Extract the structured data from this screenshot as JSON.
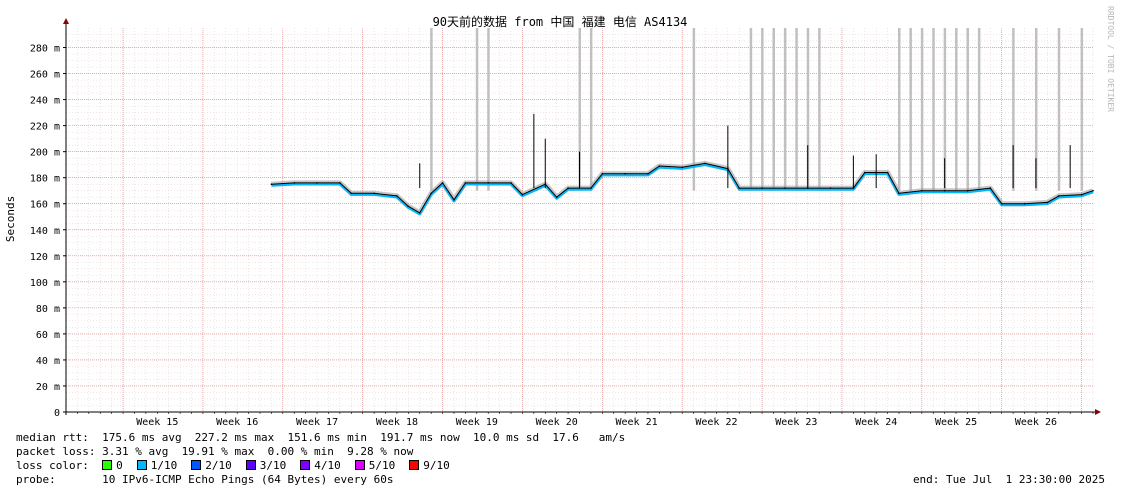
{
  "chart_data": {
    "type": "line",
    "title": "90天前的数据 from 中国 福建 电信 AS4134",
    "ylabel": "Seconds",
    "ylim": [
      0,
      0.295
    ],
    "yticks": [
      {
        "value": 0,
        "label": "0"
      },
      {
        "value": 0.02,
        "label": "20 m"
      },
      {
        "value": 0.04,
        "label": "40 m"
      },
      {
        "value": 0.06,
        "label": "60 m"
      },
      {
        "value": 0.08,
        "label": "80 m"
      },
      {
        "value": 0.1,
        "label": "100 m"
      },
      {
        "value": 0.12,
        "label": "120 m"
      },
      {
        "value": 0.14,
        "label": "140 m"
      },
      {
        "value": 0.16,
        "label": "160 m"
      },
      {
        "value": 0.18,
        "label": "180 m"
      },
      {
        "value": 0.2,
        "label": "200 m"
      },
      {
        "value": 0.22,
        "label": "220 m"
      },
      {
        "value": 0.24,
        "label": "240 m"
      },
      {
        "value": 0.26,
        "label": "260 m"
      },
      {
        "value": 0.28,
        "label": "280 m"
      }
    ],
    "xlim": [
      "2025-04-02",
      "2025-07-01"
    ],
    "week_labels": [
      {
        "date": "2025-04-10",
        "label": "Week 15"
      },
      {
        "date": "2025-04-17",
        "label": "Week 16"
      },
      {
        "date": "2025-04-24",
        "label": "Week 17"
      },
      {
        "date": "2025-05-01",
        "label": "Week 18"
      },
      {
        "date": "2025-05-08",
        "label": "Week 19"
      },
      {
        "date": "2025-05-15",
        "label": "Week 20"
      },
      {
        "date": "2025-05-22",
        "label": "Week 21"
      },
      {
        "date": "2025-05-29",
        "label": "Week 22"
      },
      {
        "date": "2025-06-05",
        "label": "Week 23"
      },
      {
        "date": "2025-06-12",
        "label": "Week 24"
      },
      {
        "date": "2025-06-19",
        "label": "Week 25"
      },
      {
        "date": "2025-06-26",
        "label": "Week 26"
      }
    ],
    "median_rtt_ms": [
      [
        "2025-04-20",
        175
      ],
      [
        "2025-04-22",
        176
      ],
      [
        "2025-04-24",
        176
      ],
      [
        "2025-04-26",
        176
      ],
      [
        "2025-04-27",
        168
      ],
      [
        "2025-04-29",
        168
      ],
      [
        "2025-05-01",
        166
      ],
      [
        "2025-05-02",
        158
      ],
      [
        "2025-05-03",
        153
      ],
      [
        "2025-05-04",
        168
      ],
      [
        "2025-05-05",
        176
      ],
      [
        "2025-05-06",
        163
      ],
      [
        "2025-05-07",
        176
      ],
      [
        "2025-05-09",
        176
      ],
      [
        "2025-05-11",
        176
      ],
      [
        "2025-05-12",
        167
      ],
      [
        "2025-05-14",
        175
      ],
      [
        "2025-05-15",
        165
      ],
      [
        "2025-05-16",
        172
      ],
      [
        "2025-05-18",
        172
      ],
      [
        "2025-05-19",
        183
      ],
      [
        "2025-05-21",
        183
      ],
      [
        "2025-05-23",
        183
      ],
      [
        "2025-05-24",
        189
      ],
      [
        "2025-05-26",
        188
      ],
      [
        "2025-05-28",
        191
      ],
      [
        "2025-05-30",
        187
      ],
      [
        "2025-05-31",
        172
      ],
      [
        "2025-06-02",
        172
      ],
      [
        "2025-06-04",
        172
      ],
      [
        "2025-06-06",
        172
      ],
      [
        "2025-06-08",
        172
      ],
      [
        "2025-06-10",
        172
      ],
      [
        "2025-06-11",
        184
      ],
      [
        "2025-06-13",
        184
      ],
      [
        "2025-06-14",
        168
      ],
      [
        "2025-06-16",
        170
      ],
      [
        "2025-06-18",
        170
      ],
      [
        "2025-06-20",
        170
      ],
      [
        "2025-06-22",
        172
      ],
      [
        "2025-06-23",
        160
      ],
      [
        "2025-06-25",
        160
      ],
      [
        "2025-06-27",
        161
      ],
      [
        "2025-06-28",
        166
      ],
      [
        "2025-06-30",
        167
      ],
      [
        "2025-07-01",
        170
      ]
    ],
    "rtt_spikes_ms": [
      [
        "2025-05-03",
        191
      ],
      [
        "2025-05-13",
        229
      ],
      [
        "2025-05-14",
        210
      ],
      [
        "2025-05-17",
        200
      ],
      [
        "2025-05-30",
        220
      ],
      [
        "2025-06-06",
        205
      ],
      [
        "2025-06-10",
        197
      ],
      [
        "2025-06-12",
        198
      ],
      [
        "2025-06-18",
        195
      ],
      [
        "2025-06-24",
        205
      ],
      [
        "2025-06-26",
        195
      ],
      [
        "2025-06-29",
        205
      ]
    ],
    "loss_bars": [
      "2025-05-04",
      "2025-05-08",
      "2025-05-09",
      "2025-05-17",
      "2025-05-18",
      "2025-05-27",
      "2025-06-01",
      "2025-06-02",
      "2025-06-03",
      "2025-06-04",
      "2025-06-05",
      "2025-06-06",
      "2025-06-07",
      "2025-06-14",
      "2025-06-15",
      "2025-06-16",
      "2025-06-17",
      "2025-06-18",
      "2025-06-19",
      "2025-06-20",
      "2025-06-21",
      "2025-06-24",
      "2025-06-26",
      "2025-06-28",
      "2025-06-30"
    ],
    "watermark": "RRDTOOL / TOBI OETIKER"
  },
  "legend": {
    "median_rtt": "median rtt:  175.6 ms avg  227.2 ms max  151.6 ms min  191.7 ms now  10.0 ms sd  17.6   am/s",
    "packet_loss": "packet loss: 3.31 % avg  19.91 % max  0.00 % min  9.28 % now",
    "loss_color_label": "loss color:  ",
    "loss_colors": [
      {
        "label": "0",
        "color": "#26ff00"
      },
      {
        "label": "1/10",
        "color": "#00b8ff"
      },
      {
        "label": "2/10",
        "color": "#0059ff"
      },
      {
        "label": "3/10",
        "color": "#5e00ff"
      },
      {
        "label": "4/10",
        "color": "#7e00ff"
      },
      {
        "label": "5/10",
        "color": "#dd00ff"
      },
      {
        "label": "9/10",
        "color": "#ff0000"
      }
    ],
    "probe": "probe:       10 IPv6-ICMP Echo Pings (64 Bytes) every 60s",
    "end": "end: Tue Jul  1 23:30:00 2025"
  }
}
